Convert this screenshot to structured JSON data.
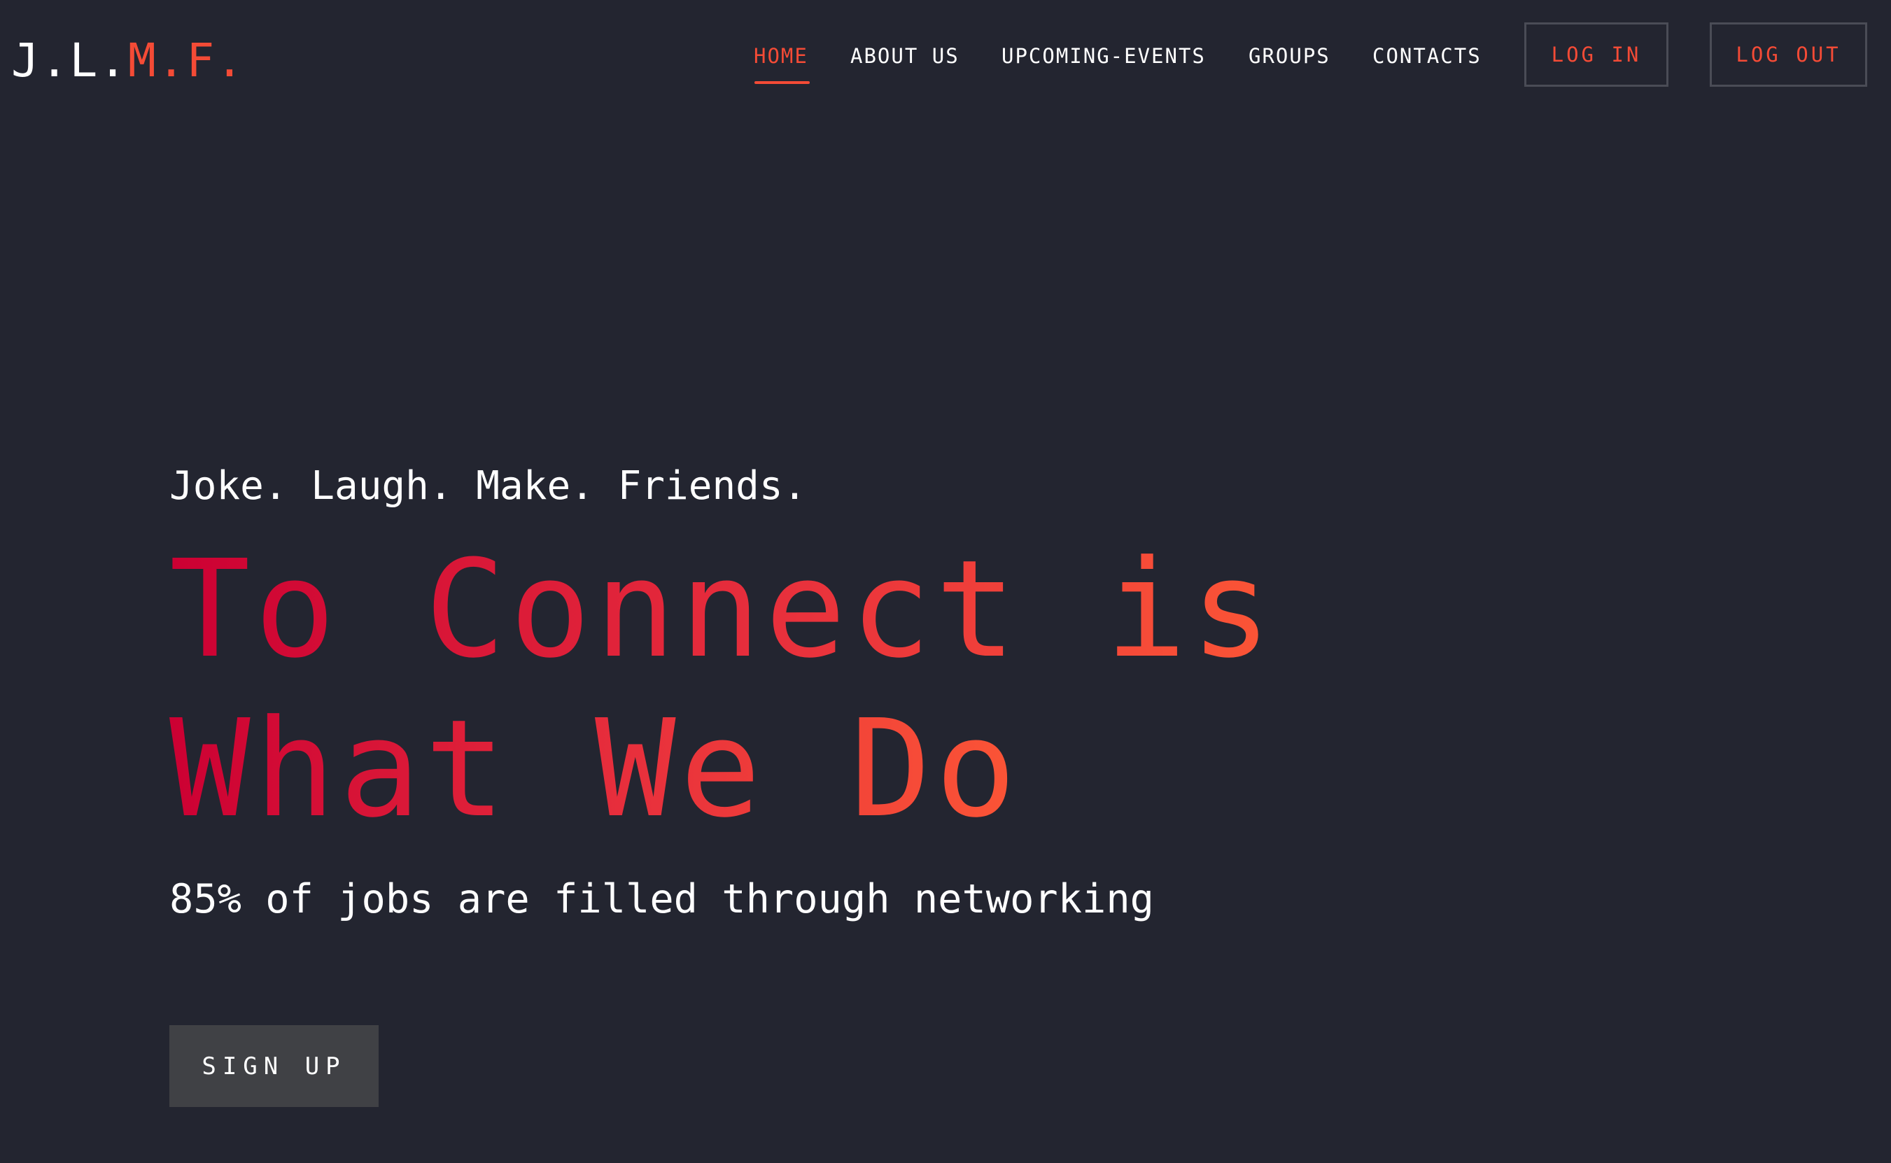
{
  "brand": {
    "logo_part1": "J.L.",
    "logo_part2": "M.F."
  },
  "nav": {
    "items": [
      {
        "label": "HOME",
        "active": true
      },
      {
        "label": "ABOUT US",
        "active": false
      },
      {
        "label": "UPCOMING-EVENTS",
        "active": false
      },
      {
        "label": "GROUPS",
        "active": false
      },
      {
        "label": "CONTACTS",
        "active": false
      }
    ],
    "login_label": "LOG IN",
    "logout_label": "LOG OUT"
  },
  "hero": {
    "tagline": "Joke. Laugh. Make. Friends.",
    "headline_line1": "To Connect is",
    "headline_line2": "What We Do",
    "subline": "85% of jobs are filled through networking",
    "signup_label": "SIGN UP"
  },
  "colors": {
    "background": "#232530",
    "accent": "#f44b36",
    "gradient_start": "#cc0033",
    "gradient_end": "#fb5536",
    "button_bg": "#404145",
    "button_border": "#4a4c56"
  }
}
